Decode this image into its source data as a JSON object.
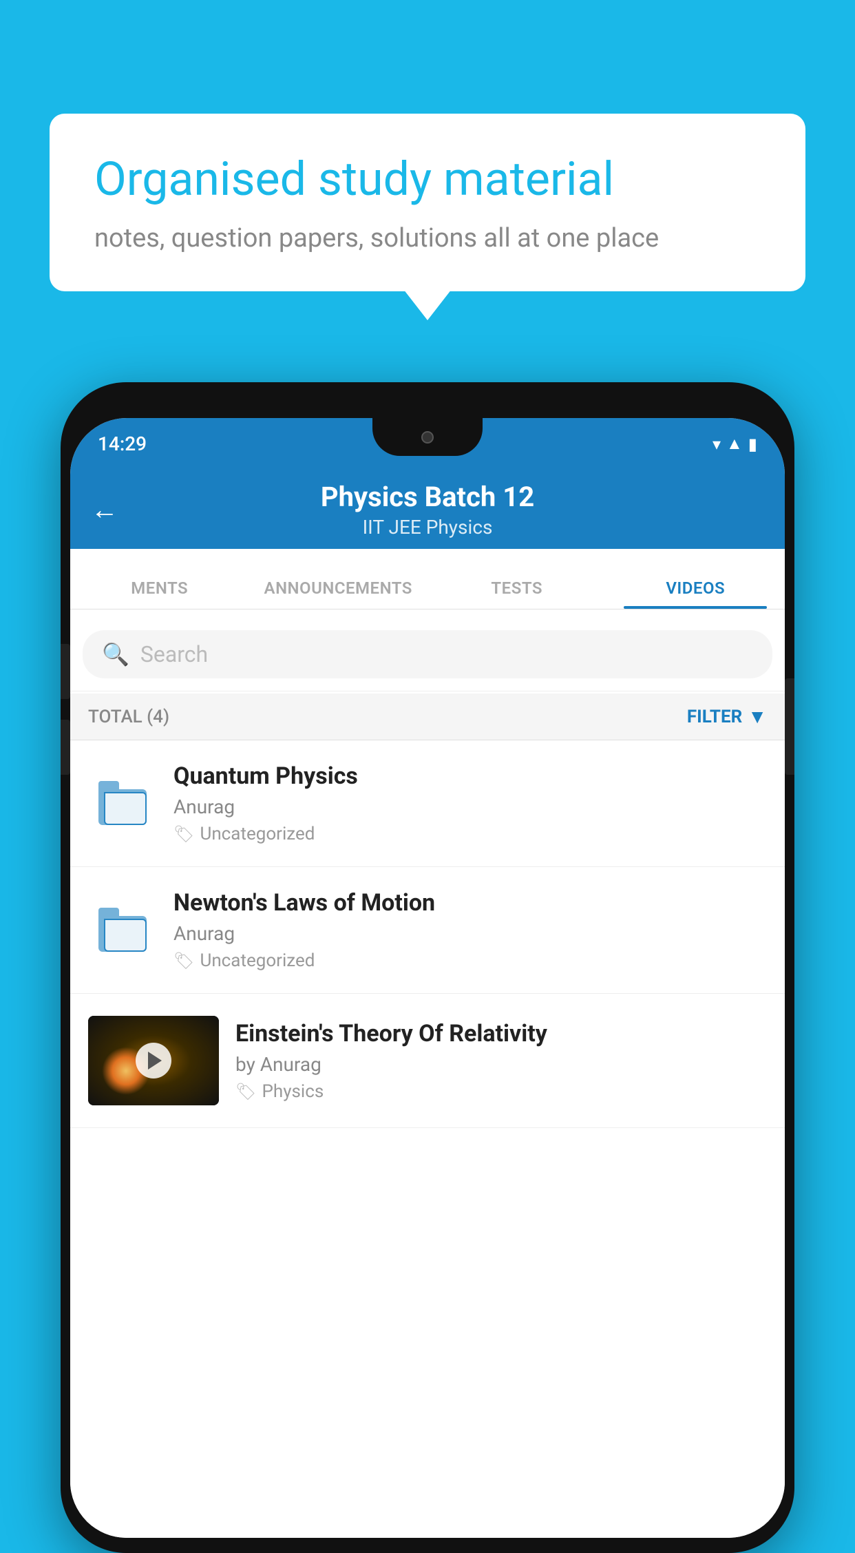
{
  "background_color": "#1ab8e8",
  "speech_bubble": {
    "title": "Organised study material",
    "subtitle": "notes, question papers, solutions all at one place"
  },
  "status_bar": {
    "time": "14:29",
    "icons": [
      "wifi",
      "signal",
      "battery"
    ]
  },
  "header": {
    "back_label": "←",
    "title": "Physics Batch 12",
    "subtitle": "IIT JEE   Physics"
  },
  "tabs": [
    {
      "label": "MENTS",
      "active": false
    },
    {
      "label": "ANNOUNCEMENTS",
      "active": false
    },
    {
      "label": "TESTS",
      "active": false
    },
    {
      "label": "VIDEOS",
      "active": true
    }
  ],
  "search": {
    "placeholder": "Search"
  },
  "filter_bar": {
    "total_label": "TOTAL (4)",
    "filter_label": "FILTER"
  },
  "list_items": [
    {
      "title": "Quantum Physics",
      "author": "Anurag",
      "tag": "Uncategorized",
      "type": "folder"
    },
    {
      "title": "Newton's Laws of Motion",
      "author": "Anurag",
      "tag": "Uncategorized",
      "type": "folder"
    },
    {
      "title": "Einstein's Theory Of Relativity",
      "author": "by Anurag",
      "tag": "Physics",
      "type": "video"
    }
  ]
}
